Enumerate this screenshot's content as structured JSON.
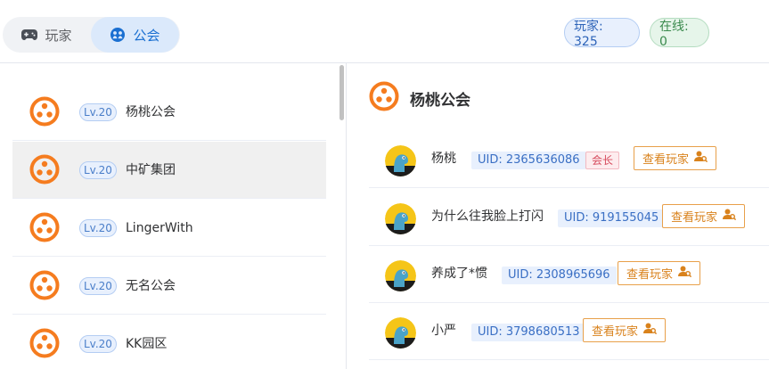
{
  "tabs": [
    {
      "label": "玩家",
      "icon": "gamepad-icon",
      "active": false
    },
    {
      "label": "公会",
      "icon": "guild-icon",
      "active": true
    }
  ],
  "stats": {
    "players": "玩家: 325",
    "online": "在线: 0"
  },
  "guilds": [
    {
      "level": "Lv.20",
      "name": "杨桃公会",
      "selected": false
    },
    {
      "level": "Lv.20",
      "name": "中矿集团",
      "selected": true
    },
    {
      "level": "Lv.20",
      "name": "LingerWith",
      "selected": false
    },
    {
      "level": "Lv.20",
      "name": "无名公会",
      "selected": false
    },
    {
      "level": "Lv.20",
      "name": "KK园区",
      "selected": false
    }
  ],
  "detail": {
    "title": "杨桃公会",
    "view_label": "查看玩家",
    "members": [
      {
        "name": "杨桃",
        "uid": "UID: 2365636086",
        "role": "会长"
      },
      {
        "name": "为什么往我脸上打闪",
        "uid": "UID: 919155045",
        "role": ""
      },
      {
        "name": "养成了*惯",
        "uid": "UID: 2308965696",
        "role": ""
      },
      {
        "name": "小严",
        "uid": "UID: 3798680513",
        "role": ""
      }
    ]
  },
  "colors": {
    "accent": "#f57c1f",
    "tab_active": "#1a6fd1",
    "button": "#d9821c"
  }
}
